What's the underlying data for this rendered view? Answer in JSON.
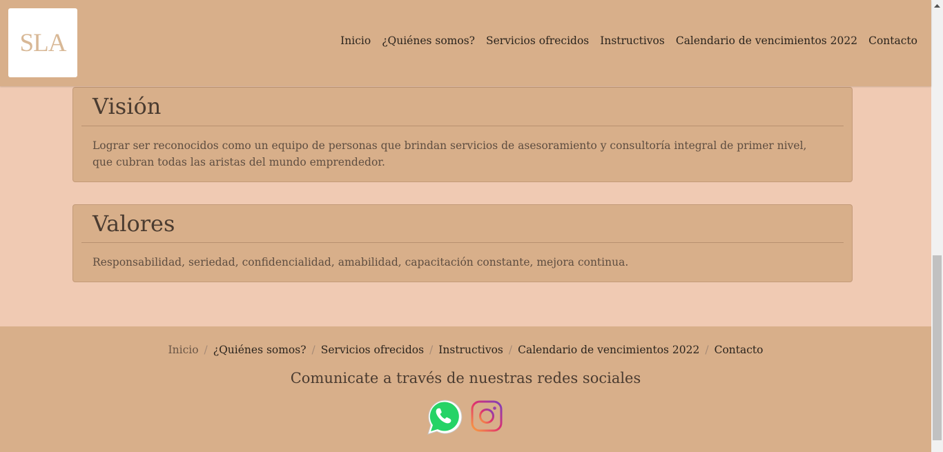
{
  "header": {
    "logo_text": "SLA",
    "nav": [
      "Inicio",
      "¿Quiénes somos?",
      "Servicios ofrecidos",
      "Instructivos",
      "Calendario de vencimientos 2022",
      "Contacto"
    ]
  },
  "vision": {
    "title": "Visión",
    "text": "Lograr ser reconocidos como un equipo de personas que brindan servicios de asesoramiento y consultoría integral de primer nivel, que cubran todas las aristas del mundo emprendedor."
  },
  "valores": {
    "title": "Valores",
    "text": "Responsabilidad, seriedad, confidencialidad, amabilidad, capacitación constante, mejora continua."
  },
  "footer": {
    "breadcrumb": [
      "Inicio",
      "¿Quiénes somos?",
      "Servicios ofrecidos",
      "Instructivos",
      "Calendario de vencimientos 2022",
      "Contacto"
    ],
    "separator": "/",
    "social_title": "Comunicate a través de nuestras redes sociales",
    "icons": [
      "whatsapp-icon",
      "instagram-icon"
    ]
  },
  "colors": {
    "background": "#f0cab3",
    "header_bg": "#d8af8a",
    "card_bg": "#d8af8a",
    "whatsapp": "#25d366"
  }
}
